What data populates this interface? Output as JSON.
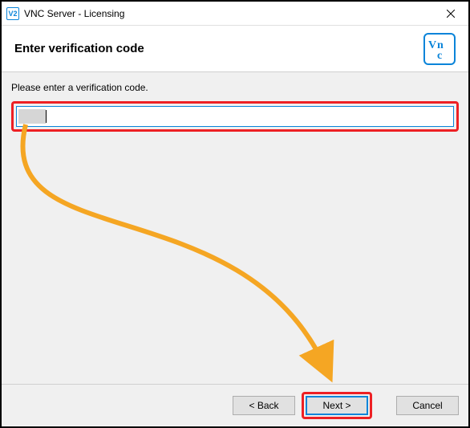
{
  "titlebar": {
    "icon_text": "V2",
    "title": "VNC Server - Licensing"
  },
  "header": {
    "title": "Enter verification code",
    "logo_text": "Vnc"
  },
  "content": {
    "instruction": "Please enter a verification code.",
    "input_value": ""
  },
  "footer": {
    "back_label": "< Back",
    "next_label": "Next >",
    "cancel_label": "Cancel"
  },
  "annotation": {
    "arrow_color": "#f5a623",
    "highlight_color": "#ed2024"
  }
}
